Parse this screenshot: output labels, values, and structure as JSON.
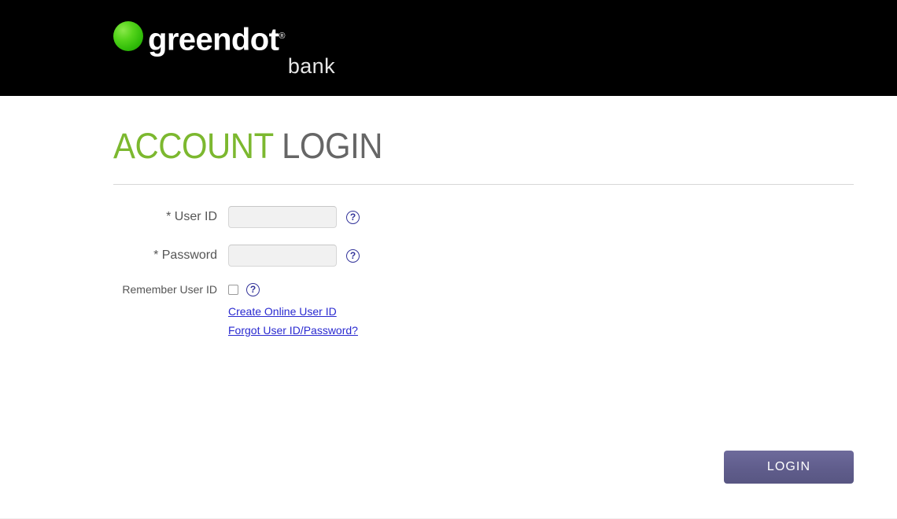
{
  "header": {
    "brand_name": "greendot",
    "brand_trademark": "®",
    "brand_sub": "bank",
    "logo_dot_color": "#3cc414",
    "background_color": "#000000"
  },
  "page": {
    "title_accent": "ACCOUNT",
    "title_rest": "LOGIN",
    "title_accent_color": "#7cb82f",
    "title_rest_color": "#666666"
  },
  "form": {
    "user_id": {
      "label": "* User ID",
      "value": "",
      "placeholder": "",
      "help_icon": "question-mark-circle-icon",
      "help_glyph": "?"
    },
    "password": {
      "label": "* Password",
      "value": "",
      "placeholder": "",
      "help_icon": "question-mark-circle-icon",
      "help_glyph": "?"
    },
    "remember": {
      "label": "Remember User ID",
      "checked": false,
      "help_icon": "question-mark-circle-icon",
      "help_glyph": "?"
    },
    "links": [
      {
        "label": "Create Online User ID"
      },
      {
        "label": "Forgot User ID/Password?"
      }
    ],
    "submit": {
      "label": "LOGIN",
      "color": "#605d8c"
    }
  }
}
